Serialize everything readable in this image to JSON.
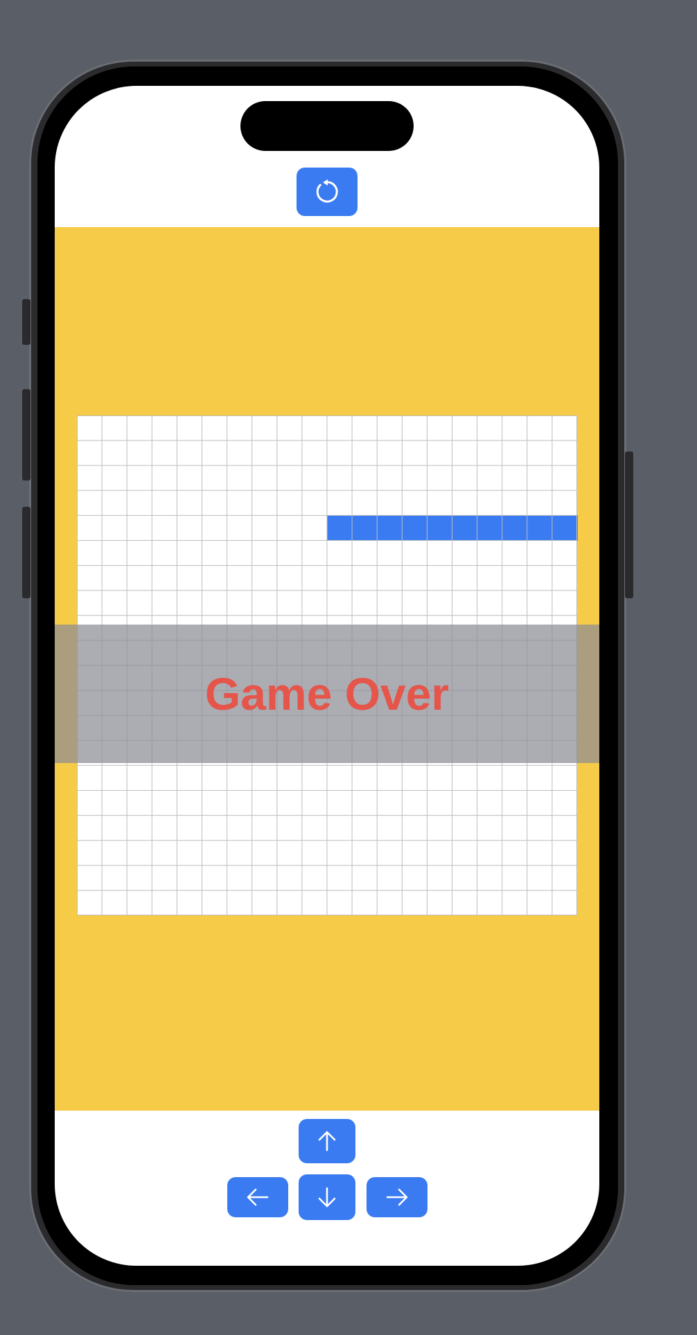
{
  "header": {
    "restart_icon": "restart-icon"
  },
  "board": {
    "columns": 20,
    "rows": 20,
    "snake": [
      {
        "row": 4,
        "col": 10
      },
      {
        "row": 4,
        "col": 11
      },
      {
        "row": 4,
        "col": 12
      },
      {
        "row": 4,
        "col": 13
      },
      {
        "row": 4,
        "col": 14
      },
      {
        "row": 4,
        "col": 15
      },
      {
        "row": 4,
        "col": 16
      },
      {
        "row": 4,
        "col": 17
      },
      {
        "row": 4,
        "col": 18
      },
      {
        "row": 4,
        "col": 19
      }
    ]
  },
  "overlay": {
    "message": "Game Over"
  },
  "controls": {
    "up_icon": "arrow-up-icon",
    "down_icon": "arrow-down-icon",
    "left_icon": "arrow-left-icon",
    "right_icon": "arrow-right-icon"
  },
  "colors": {
    "accent": "#3a7bf2",
    "game_background": "#f6cb47",
    "game_over_text": "#e5554a",
    "snake": "#3a7bf2"
  }
}
